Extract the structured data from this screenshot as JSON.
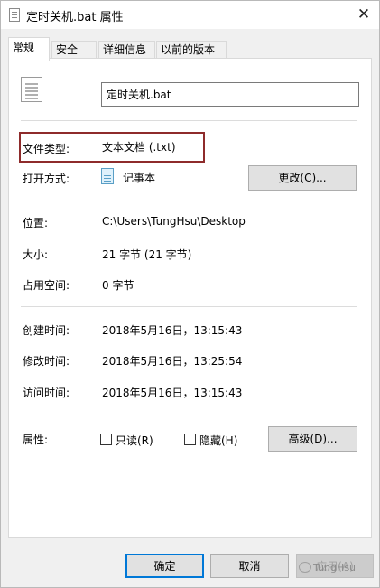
{
  "window": {
    "title": "定时关机.bat 属性",
    "close_glyph": "✕"
  },
  "tabs": [
    {
      "label": "常规"
    },
    {
      "label": "安全"
    },
    {
      "label": "详细信息"
    },
    {
      "label": "以前的版本"
    }
  ],
  "general": {
    "file_name": "定时关机.bat",
    "file_type": {
      "label": "文件类型:",
      "value": "文本文档 (.txt)"
    },
    "opens_with": {
      "label": "打开方式:",
      "value": "记事本",
      "change_button": "更改(C)..."
    },
    "location": {
      "label": "位置:",
      "value": "C:\\Users\\TungHsu\\Desktop"
    },
    "size": {
      "label": "大小:",
      "value": "21 字节 (21 字节)"
    },
    "size_on_disk": {
      "label": "占用空间:",
      "value": "0 字节"
    },
    "created": {
      "label": "创建时间:",
      "value": "2018年5月16日，13:15:43"
    },
    "modified": {
      "label": "修改时间:",
      "value": "2018年5月16日，13:25:54"
    },
    "accessed": {
      "label": "访问时间:",
      "value": "2018年5月16日，13:15:43"
    },
    "attributes": {
      "label": "属性:",
      "readonly": {
        "label": "只读(R)",
        "checked": false
      },
      "hidden": {
        "label": "隐藏(H)",
        "checked": false
      },
      "advanced_button": "高级(D)..."
    }
  },
  "footer": {
    "ok": "确定",
    "cancel": "取消",
    "apply": "应用(A)"
  },
  "watermark": "TungHsu",
  "colors": {
    "highlight_border": "#8e2b2b",
    "primary_border": "#0078d7"
  }
}
